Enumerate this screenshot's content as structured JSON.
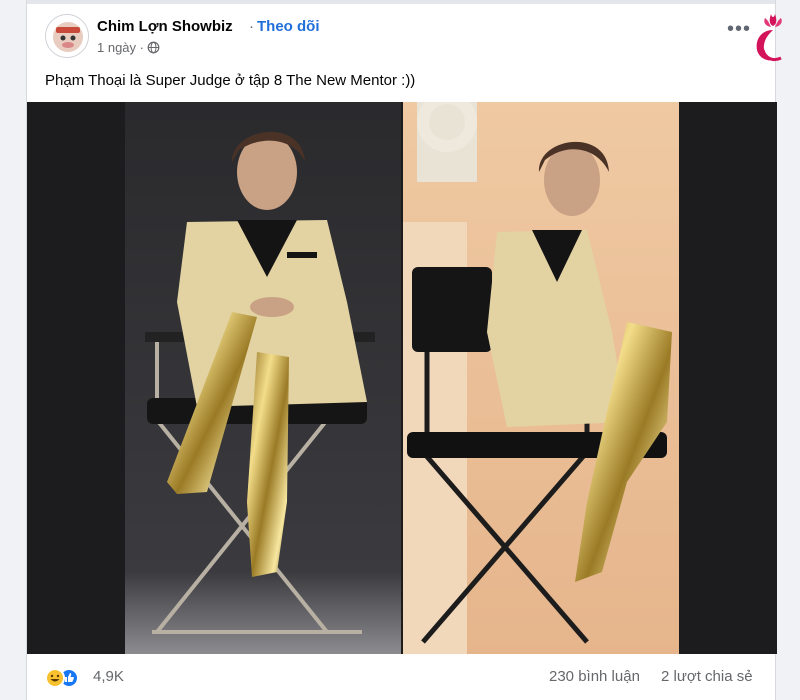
{
  "post": {
    "author": "Chim Lợn Showbiz",
    "separator": "·",
    "follow_label": "Theo dõi",
    "time": "1 ngày ·",
    "caption": "Phạm Thoại là Super Judge ở tập 8 The New Mentor :))",
    "more_label": "•••",
    "icons": {
      "avatar": "page-avatar",
      "audience": "globe-icon",
      "watermark": "lotus-logo"
    }
  },
  "engagement": {
    "reaction_count": "4,9K",
    "comments": "230 bình luận",
    "shares": "2 lượt chia sẻ",
    "reactions": [
      "haha",
      "like"
    ]
  },
  "colors": {
    "follow": "#216fdb",
    "muted": "#65676b",
    "like": "#1877f2",
    "haha": "#f7c12f",
    "logo": "#d4145a"
  }
}
